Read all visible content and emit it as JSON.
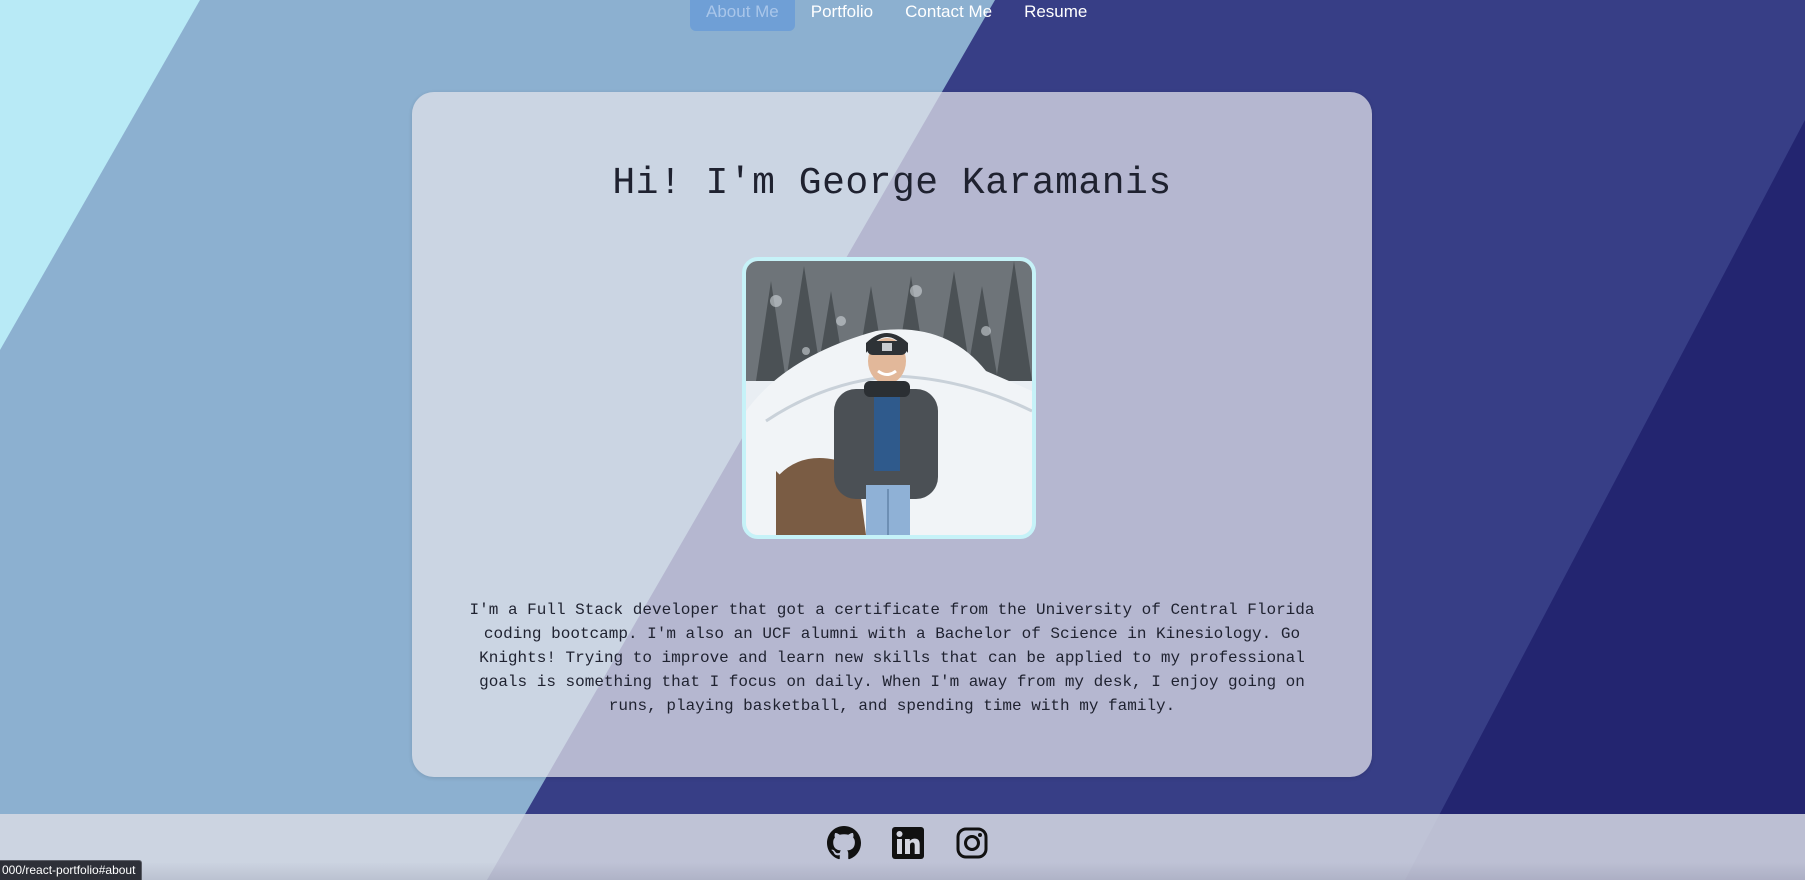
{
  "nav": {
    "items": [
      {
        "label": "About Me",
        "active": true
      },
      {
        "label": "Portfolio",
        "active": false
      },
      {
        "label": "Contact Me",
        "active": false
      },
      {
        "label": "Resume",
        "active": false
      }
    ]
  },
  "about": {
    "heading": "Hi! I'm George Karamanis",
    "bio": "I'm a Full Stack developer that got a certificate from the University of Central Florida coding bootcamp. I'm also an UCF alumni with a Bachelor of Science in Kinesiology. Go Knights! Trying to improve and learn new skills that can be applied to my professional goals is something that I focus on daily. When I'm away from my desk, I enjoy going on runs, playing basketball, and spending time with my family."
  },
  "footer": {
    "links": [
      {
        "icon": "github-icon"
      },
      {
        "icon": "linkedin-icon"
      },
      {
        "icon": "instagram-icon"
      }
    ]
  },
  "status_bar": {
    "text": "000/react-portfolio#about"
  },
  "colors": {
    "nav_active_bg": "#6f9fd6",
    "card_bg": "#e1e1ea",
    "photo_border": "#c6f2f8",
    "bg_light_cyan": "#b8eaf6",
    "bg_steel_blue": "#8cb0d0",
    "bg_indigo": "#373e86",
    "bg_navy": "#232570"
  }
}
